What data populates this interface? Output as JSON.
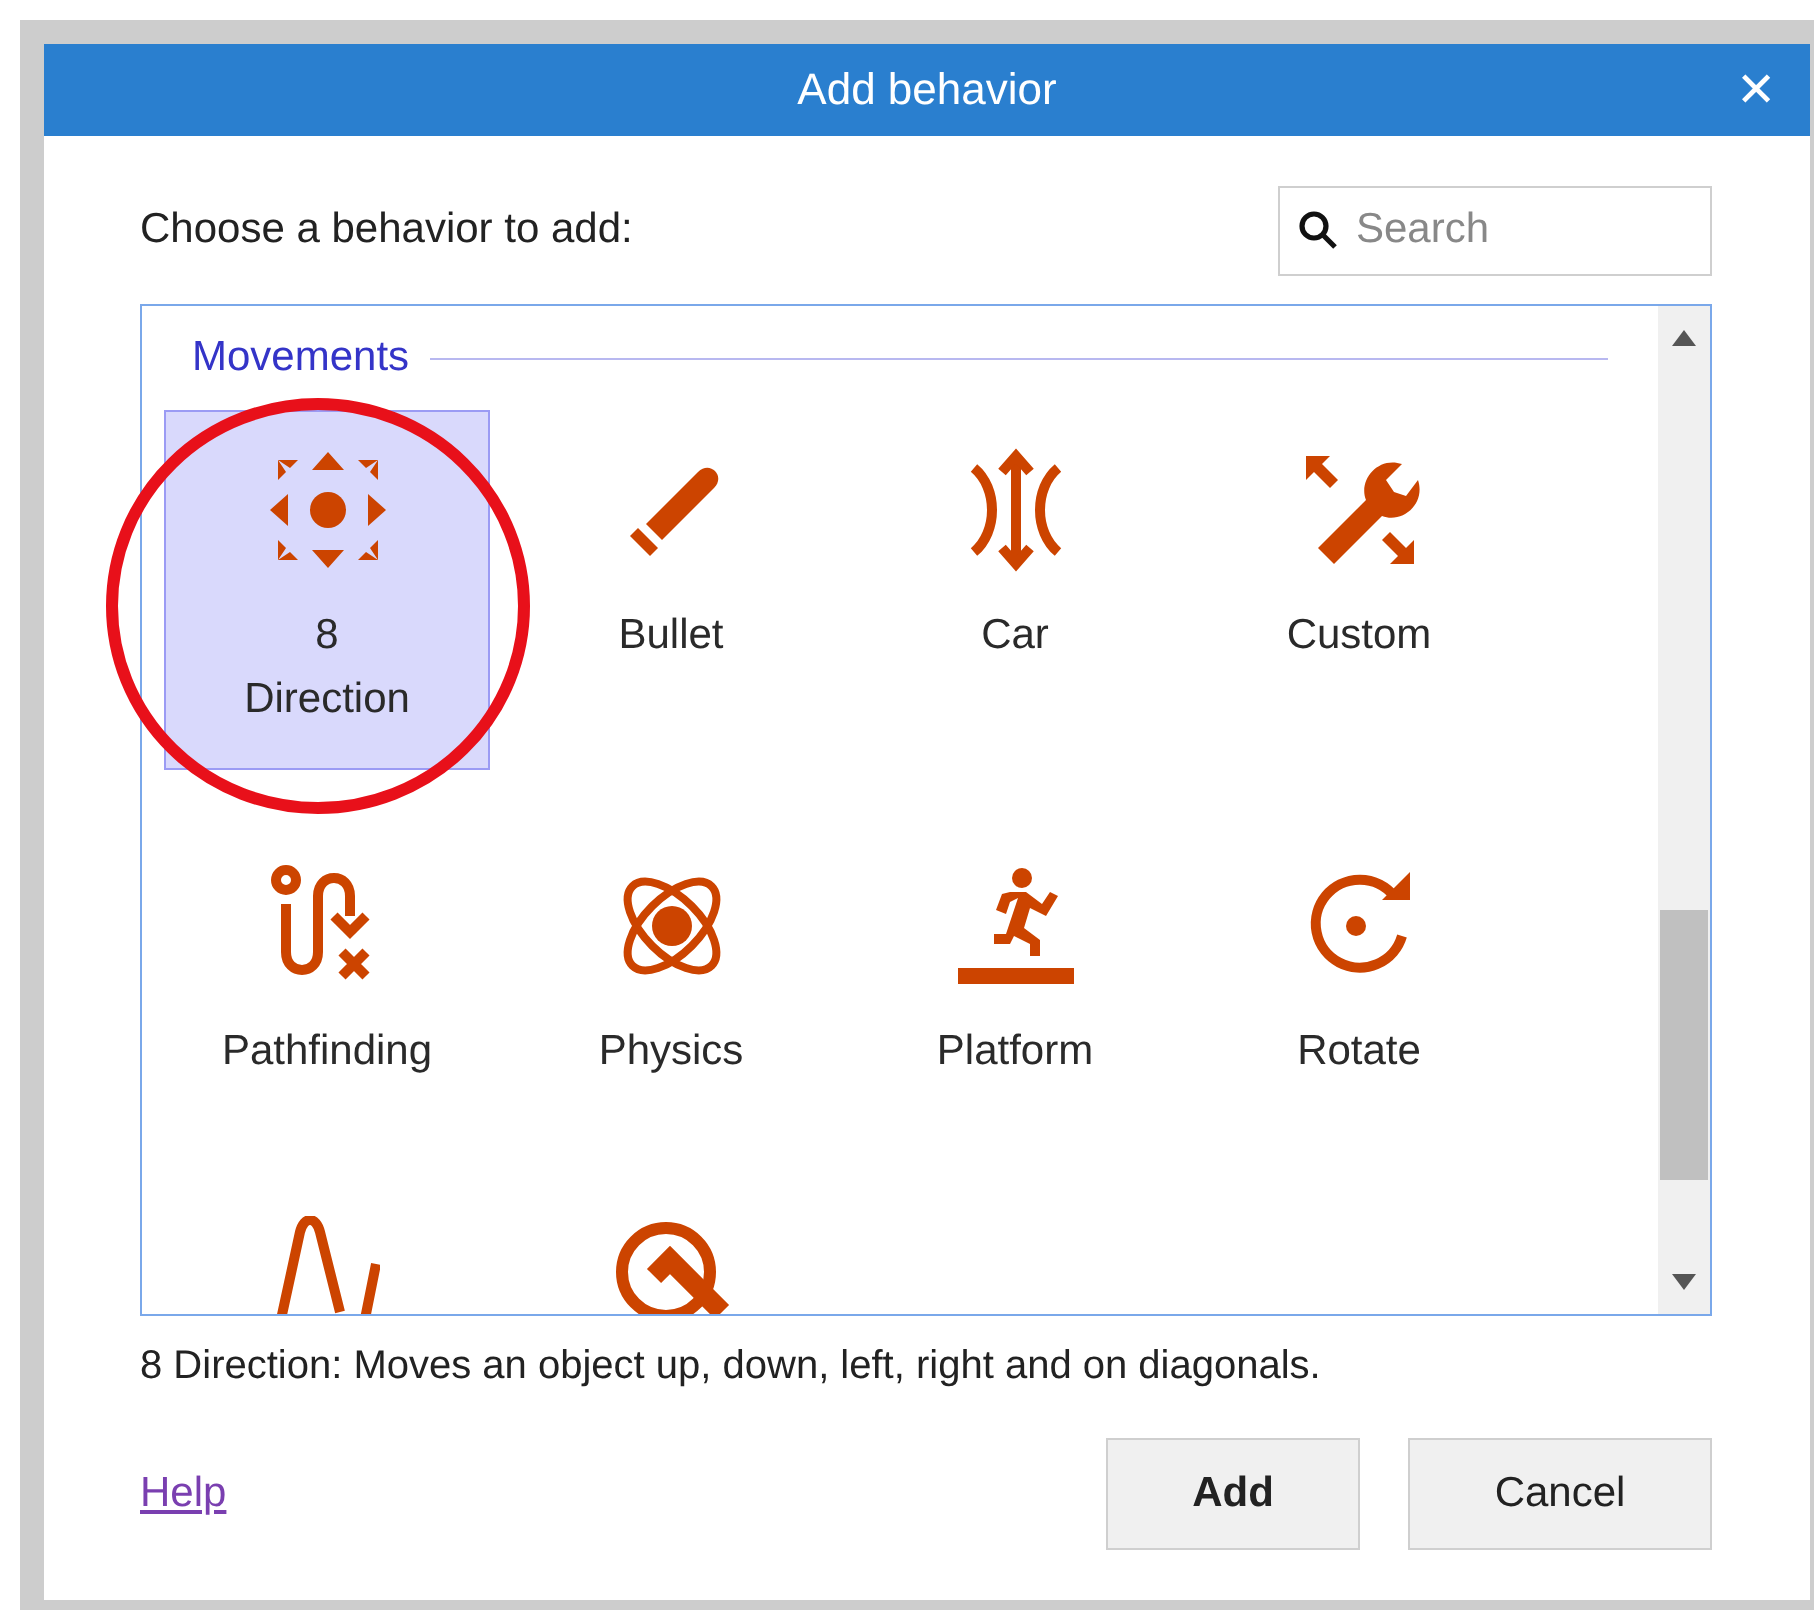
{
  "window": {
    "title": "Add behavior",
    "close": "✕"
  },
  "prompt": "Choose a behavior to add:",
  "search": {
    "placeholder": "Search"
  },
  "category": "Movements",
  "items": [
    {
      "label": "8\nDirection",
      "selected": true
    },
    {
      "label": "Bullet",
      "selected": false
    },
    {
      "label": "Car",
      "selected": false
    },
    {
      "label": "Custom",
      "selected": false
    },
    {
      "label": "Pathfinding",
      "selected": false
    },
    {
      "label": "Physics",
      "selected": false
    },
    {
      "label": "Platform",
      "selected": false
    },
    {
      "label": "Rotate",
      "selected": false
    },
    {
      "selected": false
    },
    {
      "selected": false
    }
  ],
  "description": "8 Direction: Moves an object up, down, left, right and on diagonals.",
  "help": "Help",
  "buttons": [
    {
      "label": "Add",
      "kind": "primary"
    },
    {
      "label": "Cancel",
      "kind": "normal"
    }
  ]
}
